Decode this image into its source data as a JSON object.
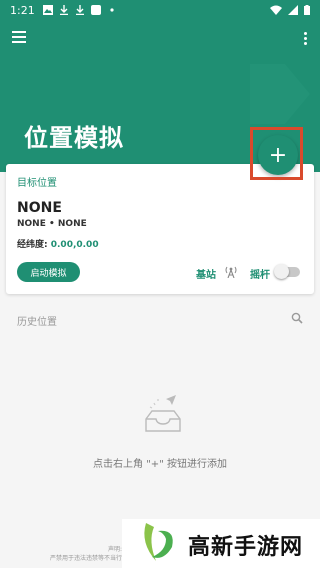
{
  "status_bar": {
    "time": "1:21",
    "icons": [
      "image-icon",
      "download-icon",
      "download-icon",
      "app-icon",
      "dot-icon"
    ],
    "right_icons": [
      "wifi-icon",
      "signal-icon",
      "battery-icon"
    ]
  },
  "header": {
    "title": "位置模拟",
    "menu_icon": "hamburger-menu-icon",
    "more_icon": "more-vert-icon",
    "fab_label": "+"
  },
  "colors": {
    "accent": "#1f8f73",
    "highlight_box": "#d94a2c"
  },
  "target_card": {
    "section_label": "目标位置",
    "name": "NONE",
    "subtitle": "NONE • NONE",
    "coords_label": "经纬度:",
    "coords_value": "0.00,0.00",
    "start_button": "启动模拟",
    "station_label": "基站",
    "station_icon": "antenna-icon",
    "joystick_label": "摇杆",
    "joystick_enabled": false
  },
  "history": {
    "label": "历史位置",
    "search_icon": "search-icon",
    "empty_icon": "empty-inbox-icon",
    "empty_text": "点击右上角 \"+\" 按钮进行添加"
  },
  "watermark": {
    "text": "高新手游网",
    "disclaimer_line1": "声明:",
    "disclaimer_line2": "严禁用于违法违禁等不当行"
  }
}
